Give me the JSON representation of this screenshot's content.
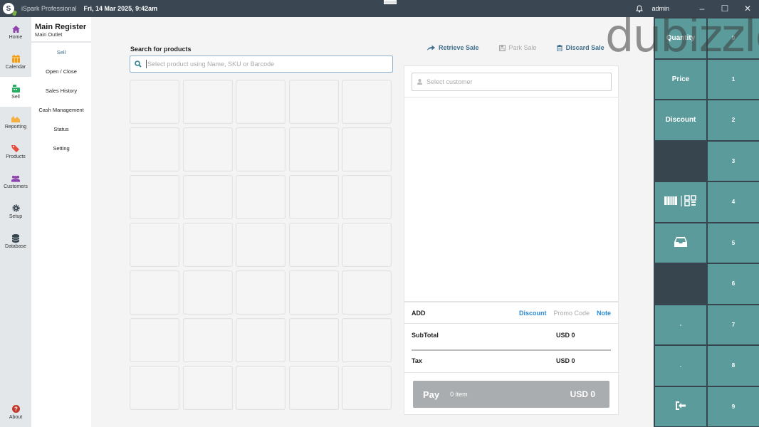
{
  "titlebar": {
    "app_name": "iSpark Professional",
    "datetime": "Fri, 14 Mar 2025, 9:42am",
    "user": "admin",
    "minimize": "–",
    "maximize": "☐",
    "close": "✕"
  },
  "leftnav": {
    "items": [
      {
        "label": "Home",
        "icon": "home-icon",
        "color": "#8e44ad"
      },
      {
        "label": "Calendar",
        "icon": "calendar-icon",
        "color": "#f39c12"
      },
      {
        "label": "Sell",
        "icon": "cash-register-icon",
        "color": "#27ae60",
        "active": true
      },
      {
        "label": "Reporting",
        "icon": "chart-icon",
        "color": "#f5b041"
      },
      {
        "label": "Products",
        "icon": "tags-icon",
        "color": "#e74c3c"
      },
      {
        "label": "Customers",
        "icon": "users-icon",
        "color": "#8e44ad"
      },
      {
        "label": "Setup",
        "icon": "gear-icon",
        "color": "#37454f"
      },
      {
        "label": "Database",
        "icon": "database-icon",
        "color": "#37454f"
      }
    ],
    "about": {
      "label": "About",
      "icon": "question-icon",
      "color": "#c0392b"
    }
  },
  "submenu": {
    "register_title": "Main Register",
    "register_subtitle": "Main Outlet",
    "items": [
      {
        "label": "Sell",
        "active": true
      },
      {
        "label": "Open / Close"
      },
      {
        "label": "Sales History"
      },
      {
        "label": "Cash Management"
      },
      {
        "label": "Status"
      },
      {
        "label": "Setting"
      }
    ]
  },
  "search": {
    "label": "Search for products",
    "placeholder": "Select product using Name, SKU or Barcode",
    "value": ""
  },
  "product_grid": {
    "rows": 7,
    "columns": 5
  },
  "sale_actions": {
    "retrieve": "Retrieve Sale",
    "park": "Park Sale",
    "discard": "Discard Sale"
  },
  "cart": {
    "customer_placeholder": "Select customer",
    "add_label": "ADD",
    "discount_link": "Discount",
    "promo_link": "Promo Code",
    "note_link": "Note",
    "subtotal_label": "SubTotal",
    "subtotal_value": "USD 0",
    "tax_label": "Tax",
    "tax_value": "USD 0",
    "pay_label": "Pay",
    "pay_count": "0 item",
    "pay_total": "USD 0"
  },
  "keypad": {
    "left": [
      {
        "label": "Quantity"
      },
      {
        "label": "Price"
      },
      {
        "label": "Discount"
      },
      {
        "label": "",
        "blank": true
      },
      {
        "label": "",
        "icon": "barcode-qr-icon"
      },
      {
        "label": "",
        "icon": "inbox-icon"
      },
      {
        "label": "",
        "blank": true
      },
      {
        "label": "-"
      },
      {
        "label": "."
      },
      {
        "label": "",
        "icon": "sign-in-icon"
      }
    ],
    "right": [
      "0",
      "1",
      "2",
      "3",
      "4",
      "5",
      "6",
      "7",
      "8",
      "9"
    ]
  },
  "watermark": "dubizzle"
}
